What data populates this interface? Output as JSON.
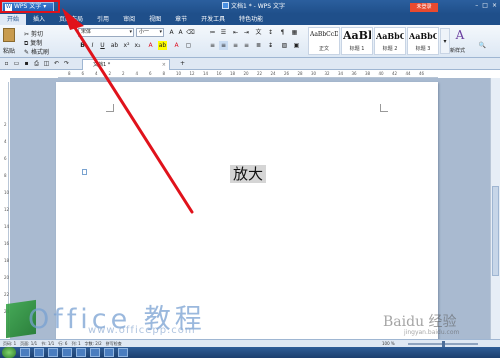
{
  "titlebar": {
    "app_button": "WPS 文字",
    "logo_letter": "W",
    "doc_title": "文档1 * - WPS 文字",
    "login_label": "未登录",
    "controls": [
      "–",
      "□",
      "×"
    ]
  },
  "menubar": {
    "items": [
      "开始",
      "插入",
      "页面布局",
      "引用",
      "审阅",
      "视图",
      "章节",
      "开发工具",
      "特色功能"
    ]
  },
  "ribbon": {
    "paste_label": "粘贴",
    "cut_label": "剪切",
    "copy_label": "复制",
    "format_painter_label": "格式刷",
    "font_name": "宋体",
    "font_size": "小一",
    "styles": [
      {
        "sample": "AaBbCcDd",
        "name": "正文"
      },
      {
        "sample": "AaBl",
        "name": "标题 1"
      },
      {
        "sample": "AaBbC",
        "name": "标题 2"
      },
      {
        "sample": "AaBbC",
        "name": "标题 3"
      }
    ],
    "new_style_label": "新样式"
  },
  "doc_tabs": {
    "tab_label": "文档1 *",
    "add_tab": "+"
  },
  "ruler": {
    "numbers": [
      "8",
      "6",
      "4",
      "2",
      "2",
      "4",
      "6",
      "8",
      "10",
      "12",
      "14",
      "16",
      "18",
      "20",
      "22",
      "24",
      "26",
      "28",
      "30",
      "32",
      "34",
      "36",
      "38",
      "40",
      "42",
      "44",
      "46"
    ],
    "vertical_numbers": [
      "2",
      "4",
      "6",
      "8",
      "10",
      "12",
      "14",
      "16",
      "18",
      "20",
      "22",
      "24"
    ]
  },
  "document": {
    "selected_text": "放大"
  },
  "statusbar": {
    "items": [
      "页码: 1",
      "页面: 1/1",
      "节: 1/1",
      "行: 6",
      "列: 1",
      "字数: 2/2",
      "拼写检查"
    ],
    "zoom": "100 %",
    "zoom_fraction": 0.5
  },
  "watermark": {
    "brand": "Office 教程",
    "url": "www.officepp.com",
    "baidu": "Baidu 经验",
    "baidu_url": "jingyan.baidu.com"
  },
  "colors": {
    "title_blue": "#1f4f8a",
    "annotation_red": "#e0121b",
    "selection_gray": "#d5d5d5"
  }
}
